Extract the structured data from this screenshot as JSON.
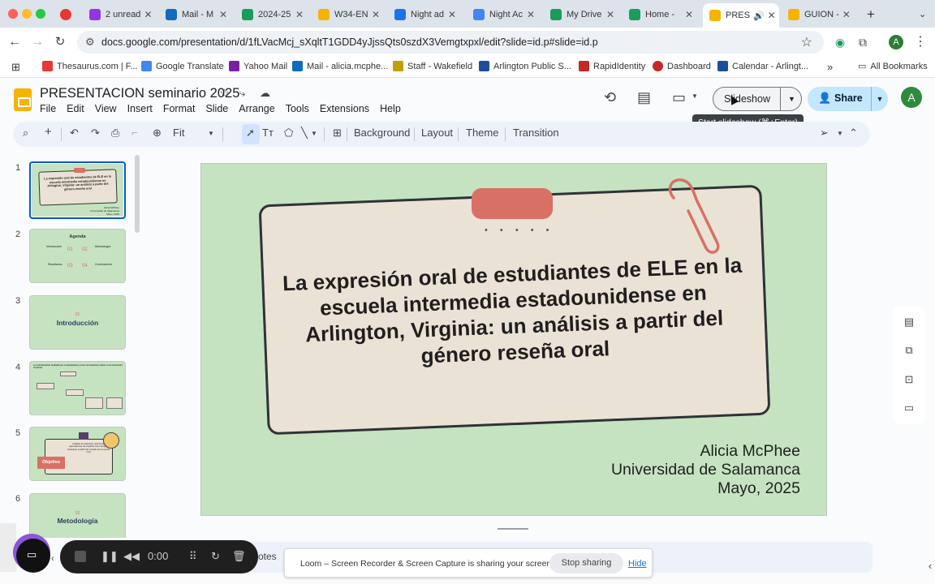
{
  "browser": {
    "tabs": [
      {
        "label": "2 unread",
        "color": "#9334e6"
      },
      {
        "label": "Mail - M",
        "color": "#0f6cbd"
      },
      {
        "label": "2024-25",
        "color": "#1a9c5b"
      },
      {
        "label": "W34-EN",
        "color": "#f4b400"
      },
      {
        "label": "Night ad",
        "color": "#1a73e8"
      },
      {
        "label": "Night Ac",
        "color": "#4285f4"
      },
      {
        "label": "My Drive",
        "color": "#1a9c5b"
      },
      {
        "label": "Home -",
        "color": "#1a9c5b"
      },
      {
        "label": "PRES",
        "color": "#f4b400"
      },
      {
        "label": "GUION -",
        "color": "#f4b400"
      }
    ],
    "url": "docs.google.com/presentation/d/1fLVacMcj_sXqltT1GDD4yJjssQts0szdX3Vemgtxpxl/edit?slide=id.p#slide=id.p",
    "profile_initial": "A",
    "bookmarks": [
      {
        "label": "Thesaurus.com | F...",
        "color": "#e53935"
      },
      {
        "label": "Google Translate",
        "color": "#4285f4"
      },
      {
        "label": "Yahoo Mail",
        "color": "#7b1fa2"
      },
      {
        "label": "Mail - alicia.mcphe...",
        "color": "#0f6cbd"
      },
      {
        "label": "Staff - Wakefield",
        "color": "#c0a000"
      },
      {
        "label": "Arlington Public S...",
        "color": "#1b4f9c"
      },
      {
        "label": "RapidIdentity",
        "color": "#c62828"
      },
      {
        "label": "Dashboard",
        "color": "#c62828"
      },
      {
        "label": "Calendar - Arlingt...",
        "color": "#1b4f9c"
      }
    ],
    "all_bookmarks": "All Bookmarks"
  },
  "app": {
    "doc_title": "PRESENTACION seminario 2025",
    "menu": [
      "File",
      "Edit",
      "View",
      "Insert",
      "Format",
      "Slide",
      "Arrange",
      "Tools",
      "Extensions",
      "Help"
    ],
    "slideshow_label": "Slideshow",
    "share_label": "Share",
    "avatar_initial": "A",
    "tooltip": "Start slideshow (⌘+Enter)"
  },
  "toolbar": {
    "zoom": "Fit",
    "background": "Background",
    "layout": "Layout",
    "theme": "Theme",
    "transition": "Transition"
  },
  "filmstrip": {
    "slides": [
      {
        "num": "1",
        "title": "La expresión oral de estudiantes de ELE en la escuela intermedia estadounidense en Arlington, Virginia: un análisis a partir del género reseña oral"
      },
      {
        "num": "2",
        "title": "Agenda",
        "items": [
          "Introducción",
          "Metodología",
          "Resultados",
          "Conclusiones"
        ],
        "nums": [
          "01",
          "02",
          "03",
          "04"
        ]
      },
      {
        "num": "3",
        "title": "Introducción",
        "pre": "01"
      },
      {
        "num": "4",
        "title": "La comunicación mediada por computadoras en las herramientas claves en la educación moderna"
      },
      {
        "num": "5",
        "title": "Objetivo",
        "text": "Analizar la expresión oral de los aprendientes de español como lengua extranjera a partir del estudio de la reseña oral"
      },
      {
        "num": "6",
        "title": "Metodología",
        "pre": "02"
      }
    ]
  },
  "slide": {
    "title": "La expresión oral de estudiantes de ELE en la escuela intermedia estadounidense en Arlington, Virginia: un análisis a partir del género reseña oral",
    "author": "Alicia McPhee",
    "institution": "Universidad de Salamanca",
    "date": "Mayo, 2025",
    "dots": "• • • • •",
    "background_color": "#c5e3c0",
    "tape_color": "#d97066"
  },
  "bottom": {
    "notes_label": "otes",
    "timer": "0:00",
    "loom_message": "Loom – Screen Recorder & Screen Capture is sharing your screen.",
    "stop_sharing": "Stop sharing",
    "hide": "Hide"
  }
}
